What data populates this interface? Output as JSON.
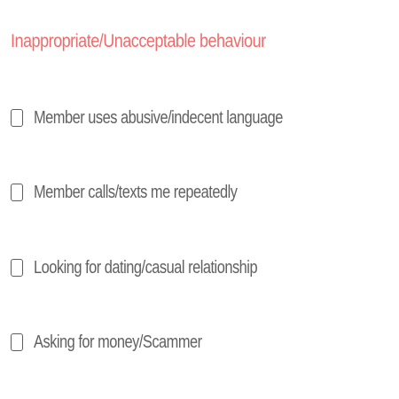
{
  "section": {
    "title": "Inappropriate/Unacceptable behaviour",
    "title_color": "#ef6b6b"
  },
  "options": [
    {
      "label": "Member uses abusive/indecent language",
      "checked": false
    },
    {
      "label": "Member calls/texts me repeatedly",
      "checked": false
    },
    {
      "label": "Looking for dating/casual relationship",
      "checked": false
    },
    {
      "label": "Asking for money/Scammer",
      "checked": false
    }
  ]
}
